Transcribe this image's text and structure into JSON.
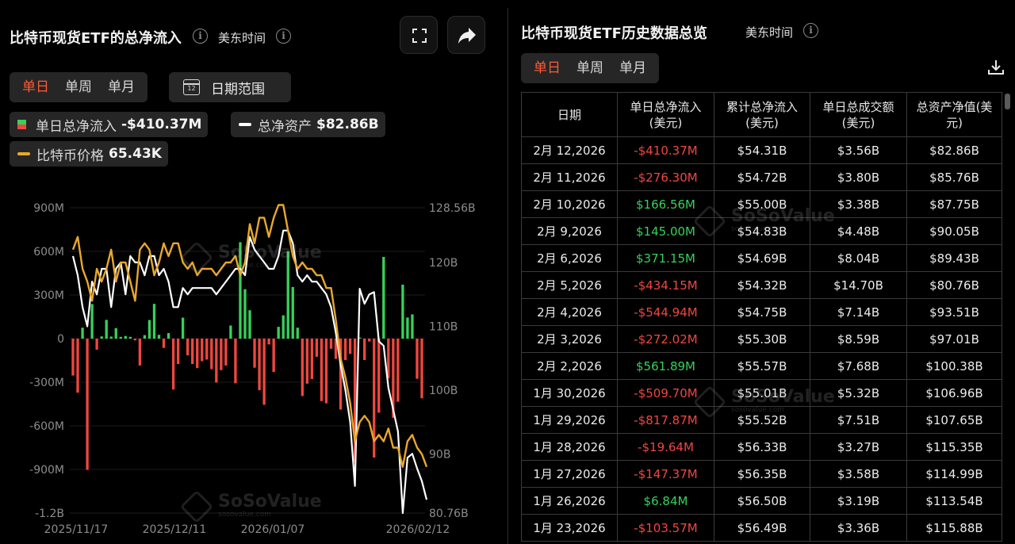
{
  "left": {
    "title": "比特币现货ETF的总净流入",
    "timezone": "美东时间",
    "tabs": [
      "单日",
      "单周",
      "单月"
    ],
    "active_tab": "单日",
    "date_range_label": "日期范围",
    "calendar_day": "12",
    "legend": [
      {
        "label": "单日总净流入",
        "value": "-$410.37M"
      },
      {
        "label": "总净资产",
        "value": "$82.86B"
      },
      {
        "label": "比特币价格",
        "value": "65.43K"
      }
    ],
    "watermark": {
      "brand": "SoSoValue",
      "url": "sosovalue.com"
    }
  },
  "right": {
    "title": "比特币现货ETF历史数据总览",
    "timezone": "美东时间",
    "tabs": [
      "单日",
      "单周",
      "单月"
    ],
    "active_tab": "单日",
    "columns": [
      "日期",
      "单日总净流入\n(美元)",
      "累计总净流入\n(美元)",
      "单日总成交额\n(美元)",
      "总资产净值(美\n元)"
    ],
    "rows": [
      [
        "2月 12,2026",
        "-$410.37M",
        "$54.31B",
        "$3.56B",
        "$82.86B"
      ],
      [
        "2月 11,2026",
        "-$276.30M",
        "$54.72B",
        "$3.80B",
        "$85.76B"
      ],
      [
        "2月 10,2026",
        "$166.56M",
        "$55.00B",
        "$3.38B",
        "$87.75B"
      ],
      [
        "2月 9,2026",
        "$145.00M",
        "$54.83B",
        "$4.48B",
        "$90.05B"
      ],
      [
        "2月 6,2026",
        "$371.15M",
        "$54.69B",
        "$8.04B",
        "$89.43B"
      ],
      [
        "2月 5,2026",
        "-$434.15M",
        "$54.32B",
        "$14.70B",
        "$80.76B"
      ],
      [
        "2月 4,2026",
        "-$544.94M",
        "$54.75B",
        "$7.14B",
        "$93.51B"
      ],
      [
        "2月 3,2026",
        "-$272.02M",
        "$55.30B",
        "$8.59B",
        "$97.01B"
      ],
      [
        "2月 2,2026",
        "$561.89M",
        "$55.57B",
        "$7.68B",
        "$100.38B"
      ],
      [
        "1月 30,2026",
        "-$509.70M",
        "$55.01B",
        "$5.32B",
        "$106.96B"
      ],
      [
        "1月 29,2026",
        "-$817.87M",
        "$55.52B",
        "$7.51B",
        "$107.65B"
      ],
      [
        "1月 28,2026",
        "-$19.64M",
        "$56.33B",
        "$3.27B",
        "$115.35B"
      ],
      [
        "1月 27,2026",
        "-$147.37M",
        "$56.35B",
        "$3.58B",
        "$114.99B"
      ],
      [
        "1月 26,2026",
        "$6.84M",
        "$56.50B",
        "$3.19B",
        "$113.54B"
      ],
      [
        "1月 23,2026",
        "-$103.57M",
        "$56.49B",
        "$3.36B",
        "$115.88B"
      ]
    ]
  },
  "colors": {
    "accent": "#ff5a36",
    "positive": "#36d159",
    "negative": "#f0473f",
    "net_assets_line": "#ffffff",
    "btc_price_line": "#e9a82a"
  },
  "chart_data": {
    "type": "bar",
    "left_axis_ticks": [
      "900M",
      "600M",
      "300M",
      "0",
      "-300M",
      "-600M",
      "-900M",
      "-1.2B"
    ],
    "right_axis_ticks": [
      "128.56B",
      "120B",
      "110B",
      "100B",
      "90B",
      "80.76B"
    ],
    "x_tick_labels": [
      "2025/11/17",
      "2025/12/11",
      "2026/01/07",
      "2026/02/12"
    ],
    "ylim_left": [
      -1200,
      900
    ],
    "ylim_right": [
      80.76,
      128.56
    ],
    "series": [
      {
        "name": "单日总净流入",
        "unit": "M USD",
        "values": [
          -254,
          -372,
          75,
          -903,
          238,
          -76,
          15,
          129,
          14,
          72,
          12,
          18,
          12,
          -12,
          -185,
          24,
          128,
          239,
          26,
          -64,
          38,
          -350,
          -175,
          144,
          -115,
          -175,
          -203,
          -155,
          -144,
          -210,
          -302,
          -217,
          -185,
          90,
          -307,
          663,
          340,
          195,
          -200,
          -355,
          -455,
          -40,
          -230,
          81,
          160,
          600,
          355,
          75,
          -395,
          -310,
          -278,
          -125,
          -430,
          -445,
          -70,
          -140,
          -488,
          -148,
          -105,
          -850,
          6.84,
          -147.37,
          -19.64,
          -817.87,
          -509.7,
          561.89,
          -272.02,
          -544.94,
          -434.15,
          371.15,
          145.0,
          166.56,
          -276.3,
          -410.37
        ]
      },
      {
        "name": "总净资产",
        "unit": "B USD",
        "values": [
          121,
          118,
          113,
          110,
          117,
          115,
          119,
          119,
          113,
          119,
          120,
          115,
          121,
          120,
          120,
          118,
          121,
          121,
          118,
          119,
          117,
          113,
          113,
          116,
          115,
          116,
          116,
          116,
          116,
          116,
          115,
          116,
          117,
          118,
          119,
          119,
          118,
          124,
          122,
          121,
          120,
          119,
          119,
          121,
          125,
          125,
          123,
          118,
          117,
          118,
          117,
          117,
          116,
          115,
          113,
          109,
          104,
          100,
          95,
          85,
          115.88,
          113.54,
          114.99,
          115.35,
          107.65,
          106.96,
          100.38,
          97.01,
          93.51,
          80.76,
          89.43,
          90.05,
          87.75,
          85.76,
          82.86
        ]
      },
      {
        "name": "比特币价格",
        "values": [
          122,
          124,
          119,
          117,
          114,
          119,
          117,
          119,
          122,
          117,
          120,
          120,
          117,
          114,
          122,
          123,
          122,
          118,
          120,
          123,
          121,
          123,
          123,
          120,
          119,
          120,
          118,
          119,
          119,
          119,
          118,
          119,
          120,
          120,
          121,
          118,
          120,
          126,
          123,
          127,
          127,
          124,
          127,
          129,
          129,
          125,
          121,
          119,
          120,
          119,
          119,
          118,
          118,
          116,
          116,
          111,
          105,
          102,
          98,
          92,
          95,
          96,
          95,
          92,
          93,
          92,
          94,
          91,
          91,
          88,
          92,
          93,
          91,
          90,
          88
        ]
      }
    ]
  }
}
